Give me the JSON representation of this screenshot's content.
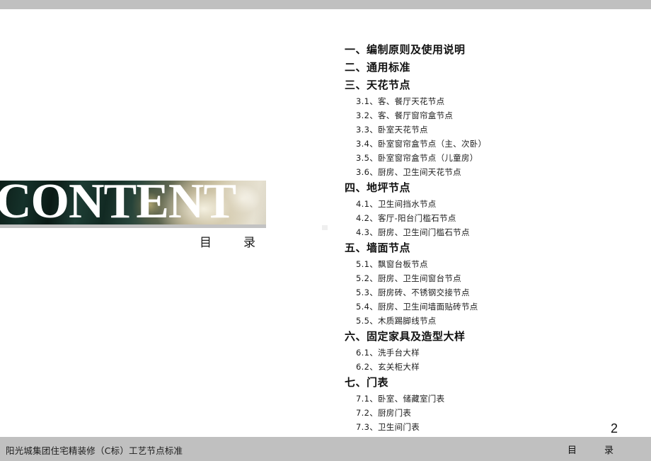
{
  "slide": {
    "kind": "presentation-table-of-contents",
    "page_number": "2",
    "colors": {
      "bar_gray": "#c0c0c0",
      "rule_gray": "#c2c2c2",
      "text_dark": "#111111",
      "photo_green": "#15312a",
      "photo_cream": "#e7e2d2"
    }
  },
  "hero": {
    "word": "CONTENT",
    "subtitle": "目　录",
    "photo_alt": "bedroom-interior-photo"
  },
  "toc": {
    "groups": [
      {
        "heading": "一、编制原则及使用说明",
        "items": []
      },
      {
        "heading": "二、通用标准",
        "items": []
      },
      {
        "heading": "三、天花节点",
        "items": [
          "3.1、客、餐厅天花节点",
          "3.2、客、餐厅窗帘盒节点",
          "3.3、卧室天花节点",
          "3.4、卧室窗帘盒节点（主、次卧）",
          "3.5、卧室窗帘盒节点（儿童房）",
          "3.6、厨房、卫生间天花节点"
        ]
      },
      {
        "heading": "四、地坪节点",
        "items": [
          "4.1、卫生间挡水节点",
          "4.2、客厅-阳台门槛石节点",
          "4.3、厨房、卫生间门槛石节点"
        ]
      },
      {
        "heading": "五、墙面节点",
        "items": [
          "5.1、飘窗台板节点",
          "5.2、厨房、卫生间窗台节点",
          "5.3、厨房砖、不锈钢交接节点",
          "5.4、厨房、卫生间墙面贴砖节点",
          "5.5、木质踢脚线节点"
        ]
      },
      {
        "heading": "六、固定家具及造型大样",
        "items": [
          "6.1、洗手台大样",
          "6.2、玄关柜大样"
        ]
      },
      {
        "heading": "七、门表",
        "items": [
          "7.1、卧室、储藏室门表",
          "7.2、厨房门表",
          "7.3、卫生间门表"
        ]
      }
    ]
  },
  "footer": {
    "left_text": "阳光城集团住宅精装修（C标）工艺节点标准",
    "right_text": "目　录"
  }
}
